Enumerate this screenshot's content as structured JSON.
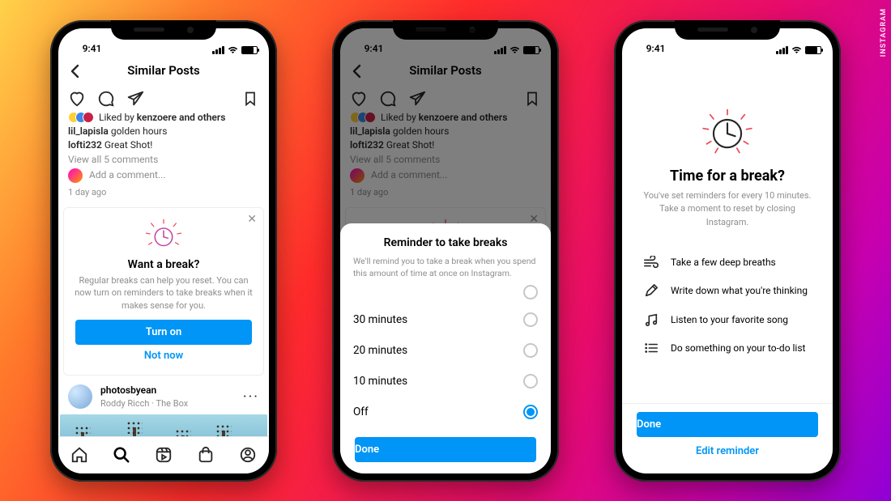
{
  "watermark": "INSTAGRAM",
  "status": {
    "time": "9:41"
  },
  "header": {
    "title": "Similar Posts"
  },
  "post": {
    "liked_by_prefix": "Liked by ",
    "liked_by_user": "kenzoere",
    "liked_by_suffix": " and others",
    "caption_user": "lil_lapisla",
    "caption_text": " golden hours",
    "comment_user": "lofti232",
    "comment_text": " Great Shot!",
    "view_all": "View all 5 comments",
    "add_comment": "Add a comment...",
    "timestamp": "1 day ago"
  },
  "break_card": {
    "title": "Want a break?",
    "desc": "Regular breaks can help you reset. You can now turn on reminders to take breaks when it makes sense for you.",
    "turn_on": "Turn on",
    "not_now": "Not now"
  },
  "suggestion": {
    "username": "photosbyean",
    "subtitle": "Roddy Ricch · The Box"
  },
  "sheet": {
    "title": "Reminder to take breaks",
    "desc": "We'll remind you to take a break when you spend this amount of time at once on Instagram.",
    "opt30": "30 minutes",
    "opt20": "20 minutes",
    "opt10": "10 minutes",
    "optOff": "Off",
    "done": "Done"
  },
  "fullbreak": {
    "title": "Time for a break?",
    "desc_line1": "You've set reminders for every 10 minutes.",
    "desc_line2": "Take a moment to reset by closing Instagram.",
    "tip1": "Take a few deep breaths",
    "tip2": "Write down what you're thinking",
    "tip3": "Listen to your favorite song",
    "tip4": "Do something on your to-do list",
    "done": "Done",
    "edit": "Edit reminder"
  }
}
